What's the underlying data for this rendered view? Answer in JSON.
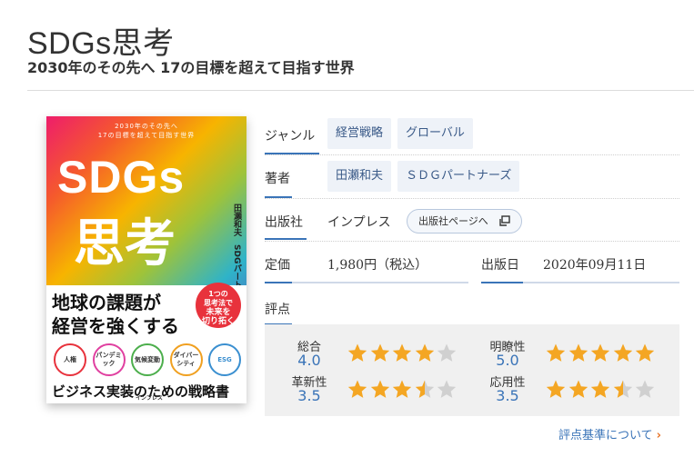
{
  "header": {
    "title": "SDGs思考",
    "subtitle": "2030年のその先へ 17の目標を超えて目指す世界"
  },
  "cover": {
    "lead_line1": "2030年のその先へ",
    "lead_line2": "17の目標を超えて目指す世界",
    "sdgs": "SDGs",
    "shiko": "思考",
    "authors": "田瀬和夫　SDGパートナーズ",
    "slogan_line1": "地球の課題が",
    "slogan_line2": "経営を強くする",
    "badge_line1": "1つの",
    "badge_line2": "思考法で",
    "badge_line3": "未来を",
    "badge_line4": "切り拓く",
    "circles": [
      "人権",
      "パンデミック",
      "気候変動",
      "ダイバーシティ",
      "ESG"
    ],
    "bottom": "ビジネス実装のための戦略書",
    "publisher": "インプレス"
  },
  "info": {
    "genre_label": "ジャンル",
    "genre_tags": [
      "経営戦略",
      "グローバル"
    ],
    "author_label": "著者",
    "author_tags": [
      "田瀬和夫",
      "ＳＤＧパートナーズ"
    ],
    "publisher_label": "出版社",
    "publisher_value": "インプレス",
    "publisher_button": "出版社ページへ",
    "price_label": "定価",
    "price_value": "1,980円（税込）",
    "date_label": "出版日",
    "date_value": "2020年09月11日",
    "rating_label": "評点"
  },
  "ratings": [
    {
      "label": "総合",
      "value": "4.0",
      "score": 4.0
    },
    {
      "label": "明瞭性",
      "value": "5.0",
      "score": 5.0
    },
    {
      "label": "革新性",
      "value": "3.5",
      "score": 3.5
    },
    {
      "label": "応用性",
      "value": "3.5",
      "score": 3.5
    }
  ],
  "links": {
    "criteria": "評点基準について"
  },
  "colors": {
    "accent": "#3a74b8",
    "star": "#f4a623",
    "star_empty": "#d0d0d0",
    "chevron": "#e8752a"
  }
}
